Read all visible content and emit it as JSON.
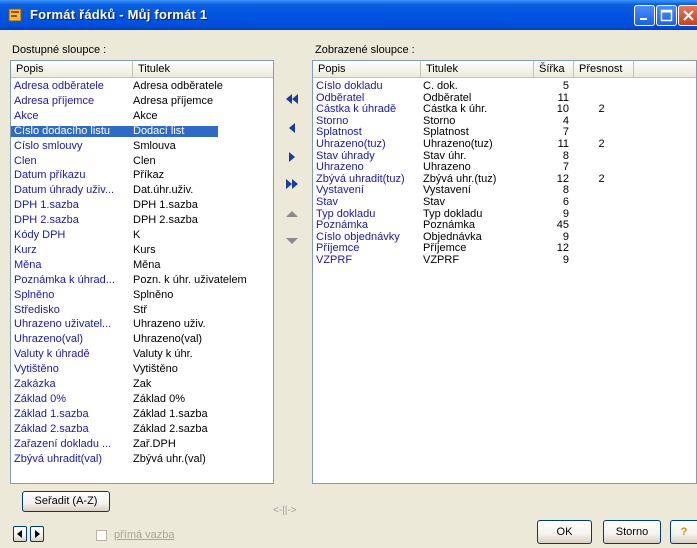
{
  "window": {
    "title": "Formát řádků - Můj formát 1"
  },
  "left_panel": {
    "label": "Dostupné sloupce :",
    "columns": [
      "Popis",
      "Titulek"
    ],
    "rows": [
      [
        "Adresa odběratele",
        "Adresa odběratele"
      ],
      [
        "Adresa příjemce",
        "Adresa příjemce"
      ],
      [
        "Akce",
        "Akce"
      ],
      [
        "Číslo dodacího listu",
        "Dodací list"
      ],
      [
        "Číslo smlouvy",
        "Smlouva"
      ],
      [
        "Člen",
        "Člen"
      ],
      [
        "Datum příkazu",
        "Příkaz"
      ],
      [
        "Datum úhrady uživ...",
        "Dat.úhr.uživ."
      ],
      [
        "DPH 1.sazba",
        "DPH 1.sazba"
      ],
      [
        "DPH 2.sazba",
        "DPH 2.sazba"
      ],
      [
        "Kódy DPH",
        "K"
      ],
      [
        "Kurz",
        "Kurs"
      ],
      [
        "Měna",
        "Měna"
      ],
      [
        "Poznámka k úhrad...",
        "Pozn. k úhr. uživatelem"
      ],
      [
        "Splněno",
        "Splněno"
      ],
      [
        "Středisko",
        "Stř"
      ],
      [
        "Uhrazeno uživatel...",
        "Uhrazeno uživ."
      ],
      [
        "Uhrazeno(val)",
        "Uhrazeno(val)"
      ],
      [
        "Valuty k úhradě",
        "Valuty k úhr."
      ],
      [
        "Vytištěno",
        "Vytištěno"
      ],
      [
        "Zakázka",
        "Zak"
      ],
      [
        "Základ 0%",
        "Základ 0%"
      ],
      [
        "Základ 1.sazba",
        "Základ 1.sazba"
      ],
      [
        "Základ 2.sazba",
        "Základ 2.sazba"
      ],
      [
        "Zařazení dokladu ...",
        "Zař.DPH"
      ],
      [
        "Zbývá uhradit(val)",
        "Zbývá uhr.(val)"
      ]
    ],
    "selected_row": "Číslo dodacího listu",
    "sort_button": "Seřadit (A-Z)"
  },
  "right_panel": {
    "label": "Zobrazené sloupce :",
    "columns": [
      "Popis",
      "Titulek",
      "Šířka",
      "Přesnost"
    ],
    "rows": [
      [
        "Číslo dokladu",
        "Č. dok.",
        "5",
        ""
      ],
      [
        "Odběratel",
        "Odběratel",
        "11",
        ""
      ],
      [
        "Částka k úhradě",
        "Částka k úhr.",
        "10",
        "2"
      ],
      [
        "Storno",
        "Storno",
        "4",
        ""
      ],
      [
        "Splatnost",
        "Splatnost",
        "7",
        ""
      ],
      [
        "Uhrazeno(tuz)",
        "Uhrazeno(tuz)",
        "11",
        "2"
      ],
      [
        "Stav úhrady",
        "Stav úhr.",
        "8",
        ""
      ],
      [
        "Uhrazeno",
        "Uhrazeno",
        "7",
        ""
      ],
      [
        "Zbývá uhradit(tuz)",
        "Zbývá uhr.(tuz)",
        "12",
        "2"
      ],
      [
        "Vystavení",
        "Vystavení",
        "8",
        ""
      ],
      [
        "Stav",
        "Stav",
        "6",
        ""
      ],
      [
        "Typ dokladu",
        "Typ dokladu",
        "9",
        ""
      ],
      [
        "Poznámka",
        "Poznámka",
        "45",
        ""
      ],
      [
        "Číslo objednávky",
        "Objednávka",
        "9",
        ""
      ],
      [
        "Příjemce",
        "Příjemce",
        "12",
        ""
      ],
      [
        "VZPRF",
        "VZPRF",
        "9",
        ""
      ]
    ]
  },
  "move_buttons": [
    {
      "name": "move-all-left-button",
      "icon": "double-left-arrow-icon"
    },
    {
      "name": "move-left-button",
      "icon": "left-arrow-icon"
    },
    {
      "name": "move-right-button",
      "icon": "right-arrow-icon"
    },
    {
      "name": "move-all-right-button",
      "icon": "double-right-arrow-icon"
    },
    {
      "name": "move-up-button",
      "icon": "up-arrow-icon"
    },
    {
      "name": "move-down-button",
      "icon": "down-arrow-icon"
    }
  ],
  "separator": "<-||->",
  "footer": {
    "checkbox_label": "přímá vazba",
    "ok_label": "OK",
    "cancel_label": "Storno",
    "help_label": "?"
  },
  "colors": {
    "accent": "#316ac5",
    "item_text": "#1a1aa8",
    "titlebar": "#0054e3"
  }
}
